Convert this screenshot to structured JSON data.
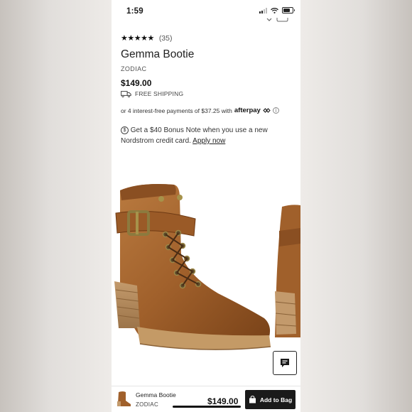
{
  "status_bar": {
    "time": "1:59"
  },
  "product": {
    "rating_stars": "★★★★★",
    "review_count": "(35)",
    "title": "Gemma Bootie",
    "brand": "ZODIAC",
    "price": "$149.00",
    "shipping": "FREE SHIPPING",
    "installments_text": "or 4 interest-free payments of $37.25 with",
    "afterpay_label": "afterpay",
    "bonus_text": "Get a $40 Bonus Note when you use a new Nordstrom credit card.",
    "bonus_link": "Apply now"
  },
  "bottom_bar": {
    "title": "Gemma Bootie",
    "brand": "ZODIAC",
    "price": "$149.00",
    "add_label": "Add to Bag"
  },
  "colors": {
    "accent": "#1a1a1a",
    "boot_brown": "#a0602b"
  }
}
